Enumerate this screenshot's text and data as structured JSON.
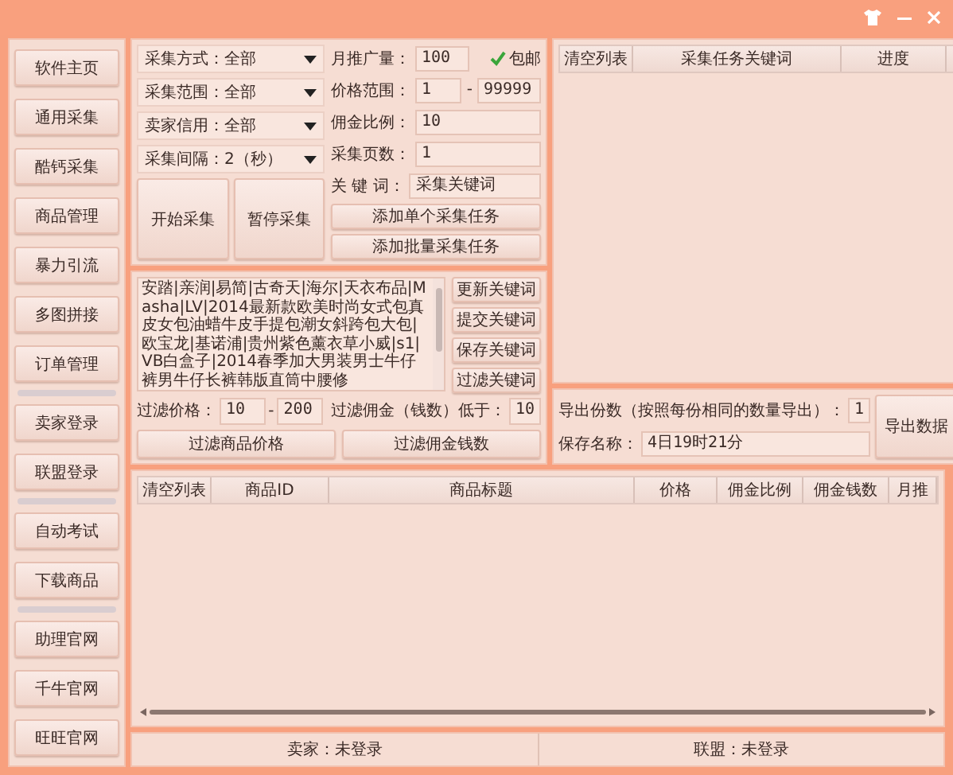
{
  "sidebar": {
    "groups": [
      {
        "items": [
          "软件主页",
          "通用采集",
          "酷钙采集",
          "商品管理",
          "暴力引流",
          "多图拼接",
          "订单管理"
        ]
      },
      {
        "items": [
          "卖家登录",
          "联盟登录"
        ]
      },
      {
        "items": [
          "自动考试",
          "下载商品"
        ]
      },
      {
        "items": [
          "助理官网",
          "千牛官网",
          "旺旺官网"
        ]
      }
    ]
  },
  "collect_form": {
    "dropdowns": [
      "采集方式：全部",
      "采集范围：全部",
      "卖家信用：全部",
      "采集间隔：2（秒）"
    ],
    "start_button": "开始采集",
    "pause_button": "暂停采集",
    "fields": [
      {
        "kind": "checkbox",
        "label": "月推广量：",
        "value": "100",
        "checkbox": {
          "label": "包邮",
          "checked": true
        }
      },
      {
        "kind": "range",
        "label": "价格范围：",
        "value": "1",
        "separator": "-",
        "value_to": "99999"
      },
      {
        "kind": "single",
        "label": "佣金比例：",
        "value": "10"
      },
      {
        "kind": "single",
        "label": "采集页数：",
        "value": "1"
      },
      {
        "kind": "single",
        "label": "关 键 词：",
        "value": "采集关键词"
      }
    ],
    "add_buttons": [
      "添加单个采集任务",
      "添加批量采集任务"
    ]
  },
  "keywords": {
    "text": "安踏|亲润|易简|古奇天|海尔|天衣布品|Masha|LV|2014最新款欧美时尚女式包真皮女包油蜡牛皮手提包潮女斜跨包大包|欧宝龙|基诺浦|贵州紫色薰衣草小威|s1|VB白盒子|2014春季加大男装男士牛仔裤男牛仔长裤韩版直筒中腰修",
    "buttons": [
      "更新关键词",
      "提交关键词",
      "保存关键词",
      "过滤关键词"
    ],
    "price_filter": {
      "label": "过滤价格：",
      "from": "10",
      "separator": "-",
      "to": "200"
    },
    "commission_filter": {
      "label": "过滤佣金（钱数）低于：",
      "value": "10"
    },
    "filter_buttons": [
      "过滤商品价格",
      "过滤佣金钱数"
    ]
  },
  "task_table": {
    "columns": [
      "清空列表",
      "采集任务关键词",
      "进度"
    ]
  },
  "export": {
    "count_label": "导出份数（按照每份相同的数量导出）：",
    "count_value": "1",
    "name_label": "保存名称：",
    "name_value": "4日19时21分",
    "button": "导出数据"
  },
  "result_table": {
    "columns": [
      "清空列表",
      "商品ID",
      "商品标题",
      "价格",
      "佣金比例",
      "佣金钱数",
      "月推"
    ]
  },
  "status_bar": [
    "卖家：未登录",
    "联盟：未登录"
  ]
}
